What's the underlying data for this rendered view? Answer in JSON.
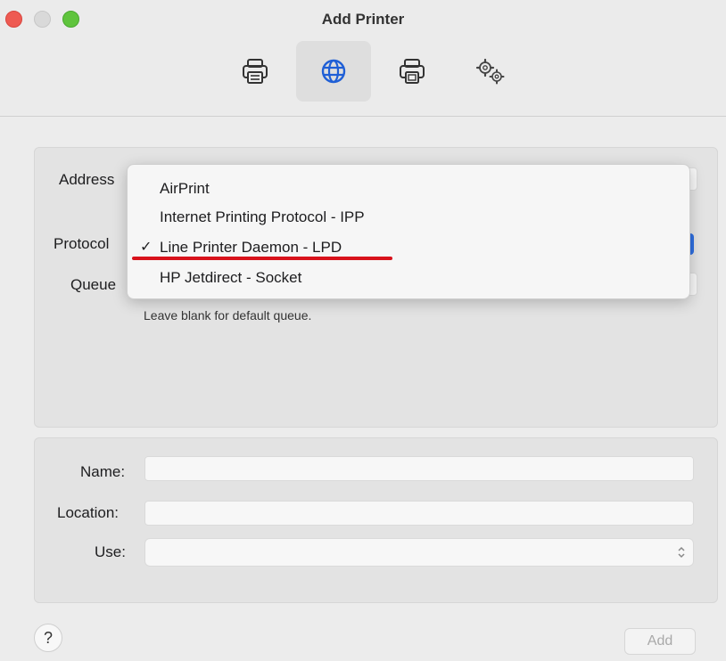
{
  "window": {
    "title": "Add Printer"
  },
  "toolbar": {
    "buttons": [
      {
        "icon": "printer-icon",
        "active": false
      },
      {
        "icon": "globe-icon",
        "active": true
      },
      {
        "icon": "printer-card-icon",
        "active": false
      },
      {
        "icon": "gears-icon",
        "active": false
      }
    ]
  },
  "ip_panel": {
    "address_label": "Address",
    "protocol_label": "Protocol",
    "queue_label": "Queue",
    "queue_hint": "Leave blank for default queue."
  },
  "protocol_menu": {
    "items": [
      {
        "label": "AirPrint",
        "checked": false
      },
      {
        "label": "Internet Printing Protocol - IPP",
        "checked": false
      },
      {
        "label": "Line Printer Daemon - LPD",
        "checked": true
      },
      {
        "label": "HP Jetdirect - Socket",
        "checked": false
      }
    ],
    "check_glyph": "✓"
  },
  "details_panel": {
    "name_label": "Name:",
    "location_label": "Location:",
    "use_label": "Use:",
    "name_value": "",
    "location_value": "",
    "use_value": ""
  },
  "footer": {
    "help_label": "?",
    "add_label": "Add"
  },
  "colors": {
    "annotation": "#d8121b",
    "accent": "#2f6fe0"
  }
}
